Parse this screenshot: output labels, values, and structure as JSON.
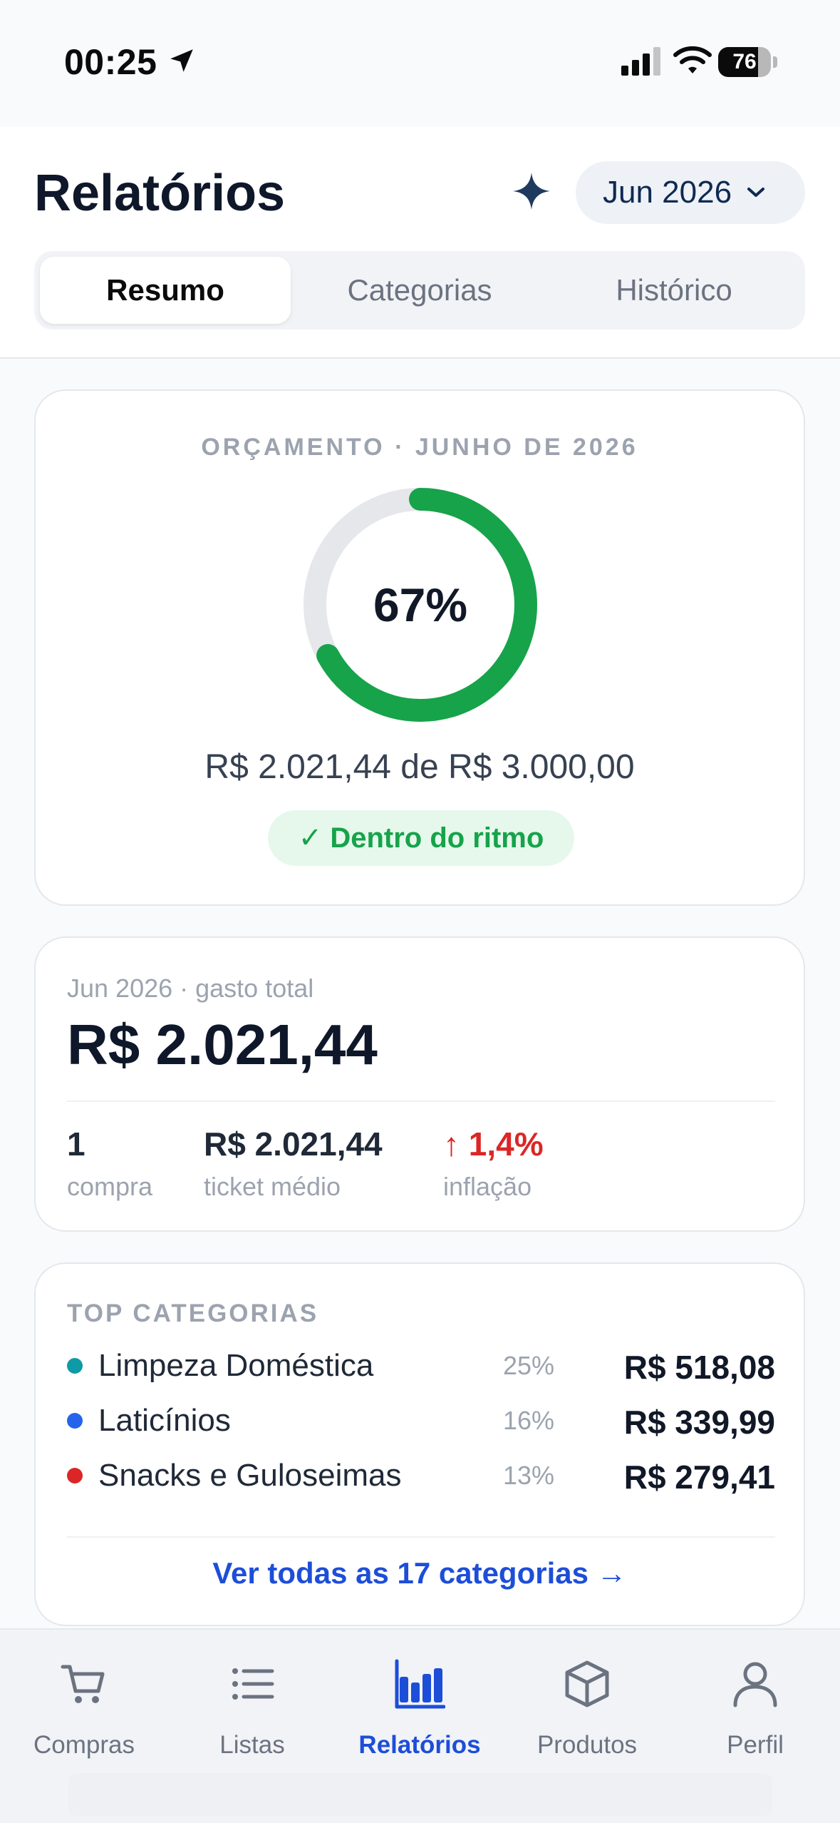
{
  "status_bar": {
    "time": "00:25",
    "battery": "76",
    "battery_level": 0.76
  },
  "header": {
    "title": "Relatórios",
    "month_selector": "Jun 2026",
    "tabs": [
      {
        "label": "Resumo",
        "active": true
      },
      {
        "label": "Categorias",
        "active": false
      },
      {
        "label": "Histórico",
        "active": false
      }
    ]
  },
  "budget": {
    "title": "ORÇAMENTO · JUNHO DE 2026",
    "percent_label": "67%",
    "percent": 67,
    "amount_text": "R$ 2.021,44 de R$ 3.000,00",
    "status": "✓ Dentro do ritmo",
    "ring_color": "#16a34a",
    "track_color": "#e5e7eb"
  },
  "spending": {
    "caption": "Jun 2026 · gasto total",
    "total": "R$ 2.021,44",
    "stats": [
      {
        "value": "1",
        "label": "compra"
      },
      {
        "value": "R$ 2.021,44",
        "label": "ticket médio"
      },
      {
        "value": "↑ 1,4%",
        "label": "inflação",
        "color": "#dc2626"
      }
    ]
  },
  "top_categories": {
    "title": "TOP CATEGORIAS",
    "items": [
      {
        "name": "Limpeza Doméstica",
        "percent": "25%",
        "value": "R$ 518,08",
        "color": "#0e9aa7"
      },
      {
        "name": "Laticínios",
        "percent": "16%",
        "value": "R$ 339,99",
        "color": "#2563eb"
      },
      {
        "name": "Snacks e Guloseimas",
        "percent": "13%",
        "value": "R$ 279,41",
        "color": "#dc2626"
      }
    ],
    "see_all": "Ver todas as 17 categorias →"
  },
  "tab_bar": {
    "items": [
      {
        "label": "Compras",
        "icon": "cart-icon",
        "active": false
      },
      {
        "label": "Listas",
        "icon": "list-icon",
        "active": false
      },
      {
        "label": "Relatórios",
        "icon": "bar-chart-icon",
        "active": true
      },
      {
        "label": "Produtos",
        "icon": "box-icon",
        "active": false
      },
      {
        "label": "Perfil",
        "icon": "person-icon",
        "active": false
      }
    ]
  },
  "colors": {
    "accent": "#1d4ed8",
    "success": "#16a34a",
    "danger": "#dc2626",
    "title": "#0f172a"
  }
}
